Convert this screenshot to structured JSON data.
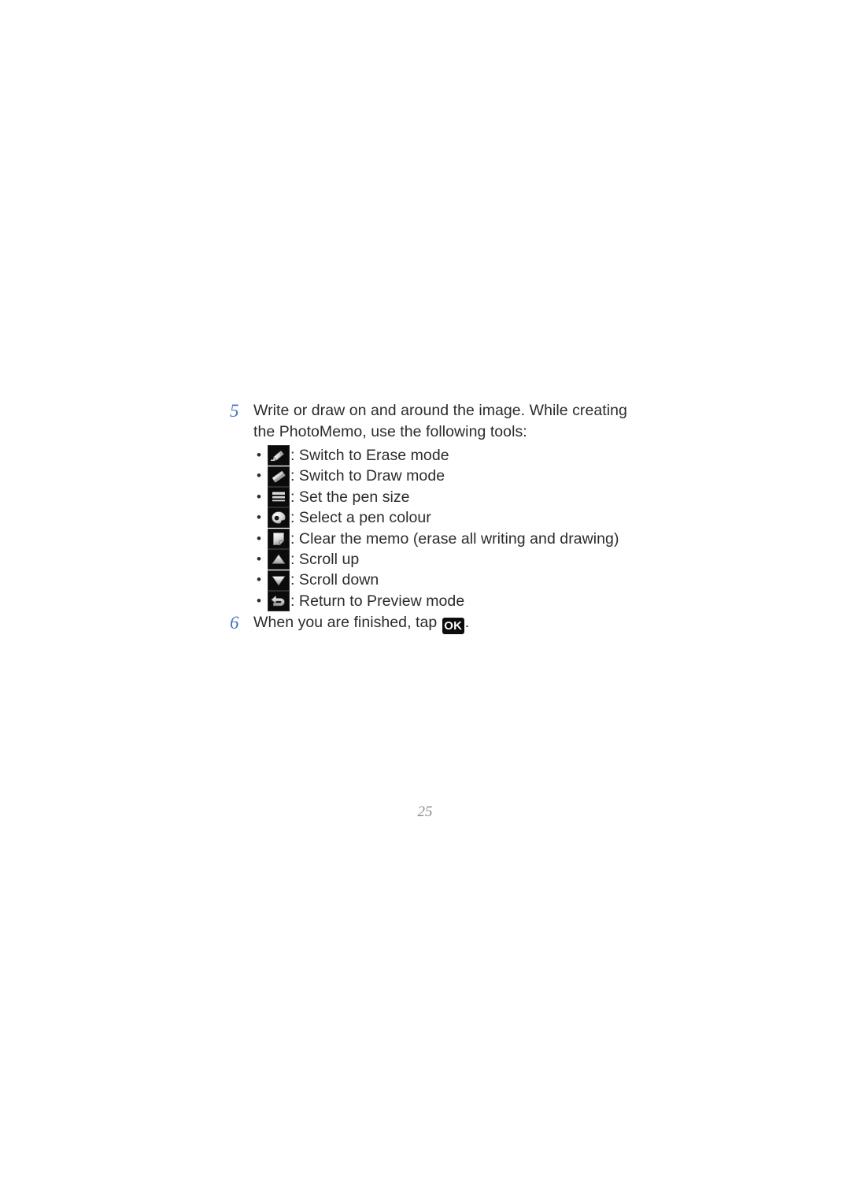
{
  "page": {
    "number": "25",
    "background": "#ffffff",
    "accent_step_color": "#4a73c8",
    "text_color": "#2b2b2b",
    "page_number_color": "#8b8b8b"
  },
  "steps": [
    {
      "number": "5",
      "text": "Write or draw on and around the image. While creating the PhotoMemo, use the following tools:"
    },
    {
      "number": "6",
      "text_before": "When you are finished, tap",
      "button_label": "OK",
      "text_after": "."
    }
  ],
  "tools": [
    {
      "bullet": "•",
      "icon": "pen-icon",
      "description": ": Switch to Erase mode"
    },
    {
      "bullet": "•",
      "icon": "eraser-icon",
      "description": ": Switch to Draw mode"
    },
    {
      "bullet": "•",
      "icon": "pen-size-icon",
      "description": ": Set the pen size"
    },
    {
      "bullet": "•",
      "icon": "palette-icon",
      "description": ": Select a pen colour"
    },
    {
      "bullet": "•",
      "icon": "clear-memo-icon",
      "description": ": Clear the memo (erase all writing and drawing)"
    },
    {
      "bullet": "•",
      "icon": "scroll-up-icon",
      "description": ": Scroll up"
    },
    {
      "bullet": "•",
      "icon": "scroll-down-icon",
      "description": ": Scroll down"
    },
    {
      "bullet": "•",
      "icon": "return-icon",
      "description": ": Return to Preview mode"
    }
  ]
}
